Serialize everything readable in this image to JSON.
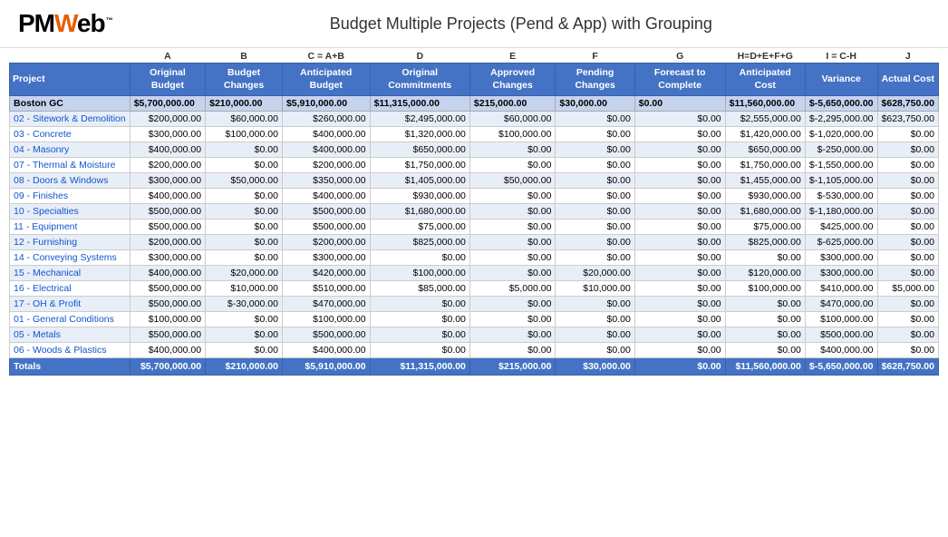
{
  "header": {
    "logo": "PMWeb",
    "title": "Budget Multiple Projects (Pend & App) with Grouping"
  },
  "columns": {
    "letters": [
      "",
      "A",
      "B",
      "C = A+B",
      "D",
      "E",
      "F",
      "G",
      "H=D+E+F+G",
      "I = C-H",
      "J"
    ],
    "headers": [
      "Project",
      "Original Budget",
      "Budget Changes",
      "Anticipated Budget",
      "Original Commitments",
      "Approved Changes",
      "Pending Changes",
      "Forecast to Complete",
      "Anticipated Cost",
      "Variance",
      "Actual Cost"
    ]
  },
  "group_header": {
    "label": "Boston GC",
    "original_budget": "$5,700,000.00",
    "budget_changes": "$210,000.00",
    "anticipated_budget": "$5,910,000.00",
    "original_commitments": "$11,315,000.00",
    "approved_changes": "$215,000.00",
    "pending_changes": "$30,000.00",
    "forecast_to_complete": "$0.00",
    "anticipated_cost": "$11,560,000.00",
    "variance": "$-5,650,000.00",
    "actual_cost": "$628,750.00"
  },
  "rows": [
    {
      "project": "02 - Sitework & Demolition",
      "original_budget": "$200,000.00",
      "budget_changes": "$60,000.00",
      "anticipated_budget": "$260,000.00",
      "original_commitments": "$2,495,000.00",
      "approved_changes": "$60,000.00",
      "pending_changes": "$0.00",
      "forecast_to_complete": "$0.00",
      "anticipated_cost": "$2,555,000.00",
      "variance": "$-2,295,000.00",
      "actual_cost": "$623,750.00"
    },
    {
      "project": "03 - Concrete",
      "original_budget": "$300,000.00",
      "budget_changes": "$100,000.00",
      "anticipated_budget": "$400,000.00",
      "original_commitments": "$1,320,000.00",
      "approved_changes": "$100,000.00",
      "pending_changes": "$0.00",
      "forecast_to_complete": "$0.00",
      "anticipated_cost": "$1,420,000.00",
      "variance": "$-1,020,000.00",
      "actual_cost": "$0.00"
    },
    {
      "project": "04 - Masonry",
      "original_budget": "$400,000.00",
      "budget_changes": "$0.00",
      "anticipated_budget": "$400,000.00",
      "original_commitments": "$650,000.00",
      "approved_changes": "$0.00",
      "pending_changes": "$0.00",
      "forecast_to_complete": "$0.00",
      "anticipated_cost": "$650,000.00",
      "variance": "$-250,000.00",
      "actual_cost": "$0.00"
    },
    {
      "project": "07 - Thermal & Moisture",
      "original_budget": "$200,000.00",
      "budget_changes": "$0.00",
      "anticipated_budget": "$200,000.00",
      "original_commitments": "$1,750,000.00",
      "approved_changes": "$0.00",
      "pending_changes": "$0.00",
      "forecast_to_complete": "$0.00",
      "anticipated_cost": "$1,750,000.00",
      "variance": "$-1,550,000.00",
      "actual_cost": "$0.00"
    },
    {
      "project": "08 - Doors & Windows",
      "original_budget": "$300,000.00",
      "budget_changes": "$50,000.00",
      "anticipated_budget": "$350,000.00",
      "original_commitments": "$1,405,000.00",
      "approved_changes": "$50,000.00",
      "pending_changes": "$0.00",
      "forecast_to_complete": "$0.00",
      "anticipated_cost": "$1,455,000.00",
      "variance": "$-1,105,000.00",
      "actual_cost": "$0.00"
    },
    {
      "project": "09 - Finishes",
      "original_budget": "$400,000.00",
      "budget_changes": "$0.00",
      "anticipated_budget": "$400,000.00",
      "original_commitments": "$930,000.00",
      "approved_changes": "$0.00",
      "pending_changes": "$0.00",
      "forecast_to_complete": "$0.00",
      "anticipated_cost": "$930,000.00",
      "variance": "$-530,000.00",
      "actual_cost": "$0.00"
    },
    {
      "project": "10 - Specialties",
      "original_budget": "$500,000.00",
      "budget_changes": "$0.00",
      "anticipated_budget": "$500,000.00",
      "original_commitments": "$1,680,000.00",
      "approved_changes": "$0.00",
      "pending_changes": "$0.00",
      "forecast_to_complete": "$0.00",
      "anticipated_cost": "$1,680,000.00",
      "variance": "$-1,180,000.00",
      "actual_cost": "$0.00"
    },
    {
      "project": "11 - Equipment",
      "original_budget": "$500,000.00",
      "budget_changes": "$0.00",
      "anticipated_budget": "$500,000.00",
      "original_commitments": "$75,000.00",
      "approved_changes": "$0.00",
      "pending_changes": "$0.00",
      "forecast_to_complete": "$0.00",
      "anticipated_cost": "$75,000.00",
      "variance": "$425,000.00",
      "actual_cost": "$0.00"
    },
    {
      "project": "12 - Furnishing",
      "original_budget": "$200,000.00",
      "budget_changes": "$0.00",
      "anticipated_budget": "$200,000.00",
      "original_commitments": "$825,000.00",
      "approved_changes": "$0.00",
      "pending_changes": "$0.00",
      "forecast_to_complete": "$0.00",
      "anticipated_cost": "$825,000.00",
      "variance": "$-625,000.00",
      "actual_cost": "$0.00"
    },
    {
      "project": "14 - Conveying Systems",
      "original_budget": "$300,000.00",
      "budget_changes": "$0.00",
      "anticipated_budget": "$300,000.00",
      "original_commitments": "$0.00",
      "approved_changes": "$0.00",
      "pending_changes": "$0.00",
      "forecast_to_complete": "$0.00",
      "anticipated_cost": "$0.00",
      "variance": "$300,000.00",
      "actual_cost": "$0.00"
    },
    {
      "project": "15 - Mechanical",
      "original_budget": "$400,000.00",
      "budget_changes": "$20,000.00",
      "anticipated_budget": "$420,000.00",
      "original_commitments": "$100,000.00",
      "approved_changes": "$0.00",
      "pending_changes": "$20,000.00",
      "forecast_to_complete": "$0.00",
      "anticipated_cost": "$120,000.00",
      "variance": "$300,000.00",
      "actual_cost": "$0.00"
    },
    {
      "project": "16 - Electrical",
      "original_budget": "$500,000.00",
      "budget_changes": "$10,000.00",
      "anticipated_budget": "$510,000.00",
      "original_commitments": "$85,000.00",
      "approved_changes": "$5,000.00",
      "pending_changes": "$10,000.00",
      "forecast_to_complete": "$0.00",
      "anticipated_cost": "$100,000.00",
      "variance": "$410,000.00",
      "actual_cost": "$5,000.00"
    },
    {
      "project": "17 - OH & Profit",
      "original_budget": "$500,000.00",
      "budget_changes": "$-30,000.00",
      "anticipated_budget": "$470,000.00",
      "original_commitments": "$0.00",
      "approved_changes": "$0.00",
      "pending_changes": "$0.00",
      "forecast_to_complete": "$0.00",
      "anticipated_cost": "$0.00",
      "variance": "$470,000.00",
      "actual_cost": "$0.00"
    },
    {
      "project": "01 - General Conditions",
      "original_budget": "$100,000.00",
      "budget_changes": "$0.00",
      "anticipated_budget": "$100,000.00",
      "original_commitments": "$0.00",
      "approved_changes": "$0.00",
      "pending_changes": "$0.00",
      "forecast_to_complete": "$0.00",
      "anticipated_cost": "$0.00",
      "variance": "$100,000.00",
      "actual_cost": "$0.00"
    },
    {
      "project": "05 - Metals",
      "original_budget": "$500,000.00",
      "budget_changes": "$0.00",
      "anticipated_budget": "$500,000.00",
      "original_commitments": "$0.00",
      "approved_changes": "$0.00",
      "pending_changes": "$0.00",
      "forecast_to_complete": "$0.00",
      "anticipated_cost": "$0.00",
      "variance": "$500,000.00",
      "actual_cost": "$0.00"
    },
    {
      "project": "06 - Woods & Plastics",
      "original_budget": "$400,000.00",
      "budget_changes": "$0.00",
      "anticipated_budget": "$400,000.00",
      "original_commitments": "$0.00",
      "approved_changes": "$0.00",
      "pending_changes": "$0.00",
      "forecast_to_complete": "$0.00",
      "anticipated_cost": "$0.00",
      "variance": "$400,000.00",
      "actual_cost": "$0.00"
    }
  ],
  "totals": {
    "label": "Totals",
    "original_budget": "$5,700,000.00",
    "budget_changes": "$210,000.00",
    "anticipated_budget": "$5,910,000.00",
    "original_commitments": "$11,315,000.00",
    "approved_changes": "$215,000.00",
    "pending_changes": "$30,000.00",
    "forecast_to_complete": "$0.00",
    "anticipated_cost": "$11,560,000.00",
    "variance": "$-5,650,000.00",
    "actual_cost": "$628,750.00"
  }
}
